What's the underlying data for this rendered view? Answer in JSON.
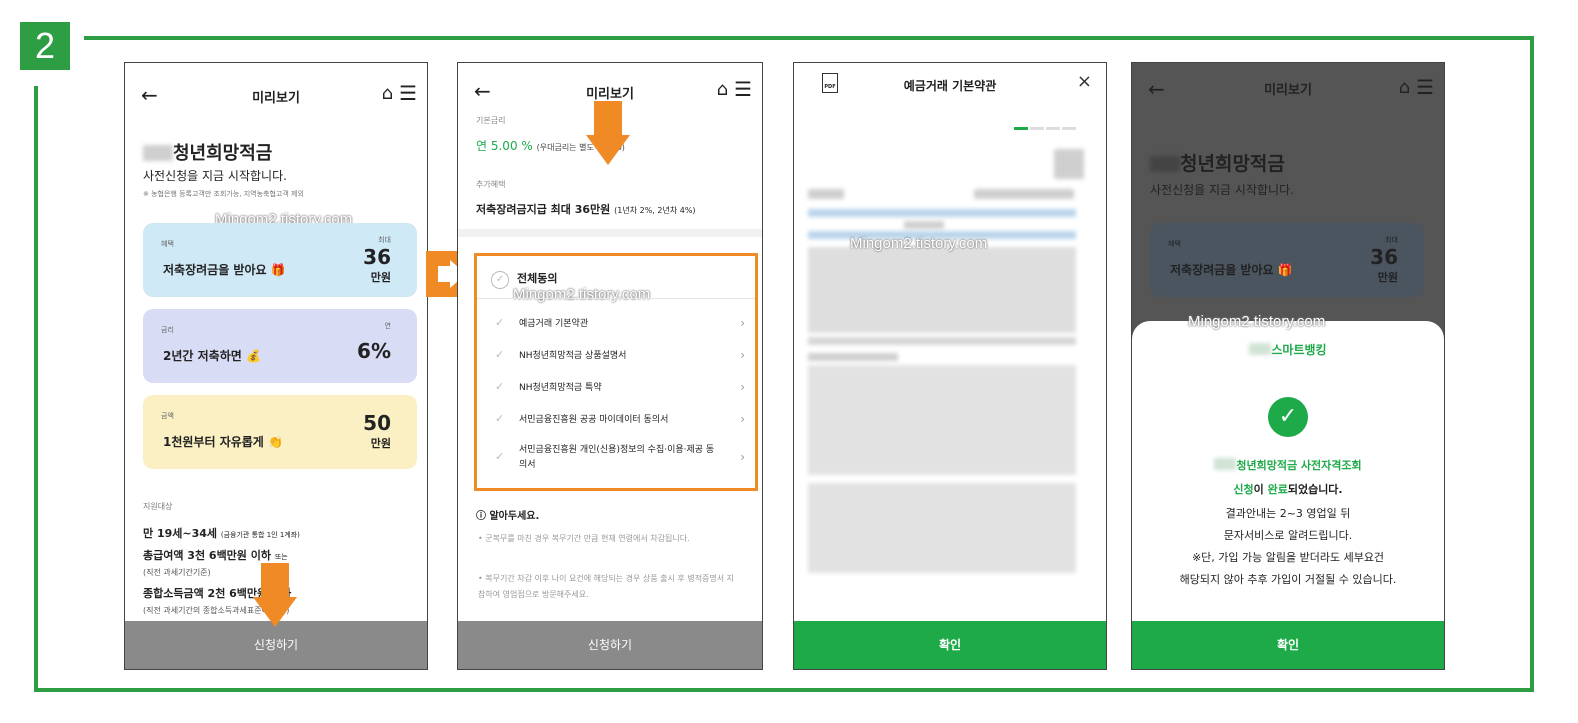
{
  "step": "2",
  "watermark": "Mingom2.tistory.com",
  "phone1": {
    "title": "미리보기",
    "product_name": "청년희망적금",
    "subtitle": "사전신청을 지금 시작합니다.",
    "note": "※ 농협은행 등록고객만 조회가능, 지역농축협고객 제외",
    "cards": [
      {
        "tag": "혜택",
        "text": "저축장려금을 받아요 🎁",
        "unit_top": "최대",
        "value": "36",
        "unit": "만원",
        "color": "#cfe9f7"
      },
      {
        "tag": "금리",
        "text": "2년간 저축하면 💰",
        "unit_top": "연",
        "value": "6%",
        "unit": "",
        "color": "#d9dcf5"
      },
      {
        "tag": "금액",
        "text": "1천원부터 자유롭게 👏",
        "unit_top": "",
        "value": "50",
        "unit": "만원",
        "color": "#faf0c4"
      }
    ],
    "target_label": "지원대상",
    "age": "만 19세~34세",
    "age_note": "(금융기관 통합 1인 1계좌)",
    "income_gross": "총급여액 3천 6백만원 이하",
    "income_gross_or": "또는",
    "income_gross_note": "(직전 과세기간기준)",
    "income_total": "종합소득금액 2천 6백만원 이하",
    "income_total_note": "(직전 과세기간의 종합소득과세표준에 합산)",
    "button": "신청하기"
  },
  "phone2": {
    "title": "미리보기",
    "base_rate_label": "기본금리",
    "base_rate": "연 5.00 %",
    "base_rate_note": "(우대금리는 별도 1.0%p)",
    "extra_label": "추가혜택",
    "bonus": "저축장려금지급 최대 36만원",
    "bonus_note": "(1년차 2%, 2년차 4%)",
    "agree_all": "전체동의",
    "agree_items": [
      "예금거래 기본약관",
      "NH청년희망적금 상품설명서",
      "NH청년희망적금 특약",
      "서민금융진흥원 공공 마이데이터 동의서",
      "서민금융진흥원 개인(신용)정보의 수집·이용·제공 동의서"
    ],
    "notice_title": "알아두세요.",
    "notices": [
      "군복무를 마친 경우 복무기간 만큼 현재 연령에서 차감됩니다.",
      "복무기간 차감 이후 나이 요건에 해당되는 경우 상품 출시 후 병적증명서 지참하여 영업점으로 방문해주세요."
    ],
    "button": "신청하기"
  },
  "phone3": {
    "pdf_icon": "PDF",
    "title": "예금거래 기본약관",
    "close": "×",
    "button": "확인"
  },
  "phone4": {
    "title": "미리보기",
    "product_name": "청년희망적금",
    "subtitle": "사전신청을 지금 시작합니다.",
    "card_tag": "혜택",
    "card_text": "저축장려금을 받아요 🎁",
    "card_unit_top": "최대",
    "card_value": "36",
    "card_unit": "만원",
    "brand": "스마트뱅킹",
    "check": "✓",
    "line1": "청년희망적금 사전자격조회",
    "line2_a": "신청",
    "line2_b": "이 ",
    "line2_c": "완료",
    "line2_d": "되었습니다.",
    "line3": "결과안내는 2~3 영업일 뒤",
    "line4": "문자서비스로 알려드립니다.",
    "line5": "※단, 가입 가능 알림을 받더라도 세부요건",
    "line6": "해당되지 않아 추후 가입이 거절될 수 있습니다.",
    "button": "확인"
  },
  "colors": {
    "accent": "#2e9e45",
    "primary": "#1faa4a",
    "arrow": "#f08a24"
  }
}
